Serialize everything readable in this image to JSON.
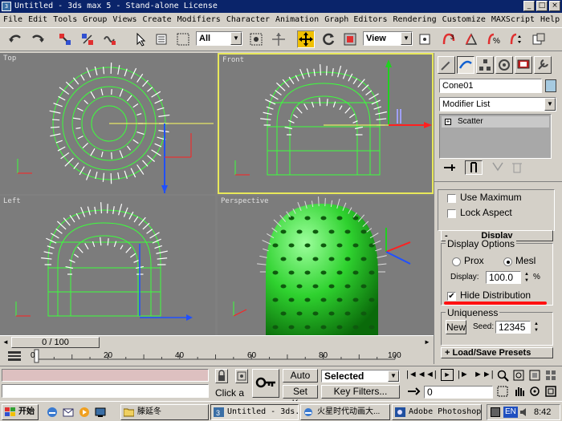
{
  "window": {
    "title": "Untitled - 3ds max 5 - Stand-alone License",
    "app_icon": "3ds-max-icon"
  },
  "menu": [
    "File",
    "Edit",
    "Tools",
    "Group",
    "Views",
    "Create",
    "Modifiers",
    "Character",
    "Animation",
    "Graph Editors",
    "Rendering",
    "Customize",
    "MAXScript",
    "Help"
  ],
  "toolbar": {
    "selection_filter": "All",
    "ref_coord_system": "View"
  },
  "viewports": {
    "top_left": "Top",
    "top_right": "Front",
    "bottom_left": "Left",
    "bottom_right": "Perspective"
  },
  "command_panel": {
    "object_name": "Cone01",
    "object_color": "#a6cae0",
    "modifier_list": "Modifier List",
    "stack_item": "Scatter",
    "use_maximum": "Use Maximum",
    "lock_aspect": "Lock Aspect",
    "display_rollout": "Display",
    "display_options": "Display Options",
    "proxies": "Prox",
    "mesh": "Mesl",
    "display_label": "Display:",
    "display_value": "100.0",
    "percent": "%",
    "hide_distribution": "Hide Distribution",
    "uniqueness": "Uniqueness",
    "new_button": "New",
    "seed_label": "Seed:",
    "seed_value": "12345",
    "load_save": "Load/Save Presets"
  },
  "time": {
    "slider_label": "0 / 100",
    "frame_value": "0",
    "ticks": [
      "0",
      "20",
      "40",
      "60",
      "80",
      "100"
    ]
  },
  "status": {
    "click_prompt": "Click a",
    "auto_key": "Auto Key",
    "set_key": "Set Key",
    "selected": "Selected",
    "key_filters": "Key Filters..."
  },
  "taskbar": {
    "start": "开始",
    "folder": "滕延冬",
    "max_task": "Untitled - 3ds...",
    "ie_task": "火星时代动画大...",
    "ps_task": "Adobe Photoshop",
    "lang": "EN",
    "clock": "8:42"
  },
  "colors": {
    "titlebar": "#0a246a",
    "wireframe": "#3cff3c",
    "sphere": "#2fd22f",
    "active_viewport": "#e8e85a",
    "annotation": "#ff1010"
  }
}
